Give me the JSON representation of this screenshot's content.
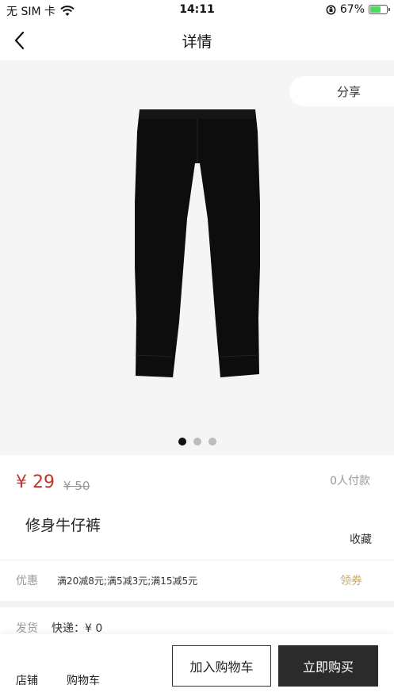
{
  "status_bar": {
    "carrier": "无 SIM 卡",
    "time": "14:11",
    "battery": "67%",
    "battery_level": 0.67
  },
  "nav": {
    "title": "详情",
    "back_icon": "chevron-left-icon"
  },
  "gallery": {
    "share_label": "分享",
    "image_subject": "black-pants",
    "dot_count": 3,
    "active_dot": 0
  },
  "price": {
    "current": "¥ 29",
    "original": "¥ 50",
    "paid_count": "0人付款"
  },
  "product": {
    "name": "修身牛仔裤",
    "favorite_label": "收藏"
  },
  "promo": {
    "label": "优惠",
    "text": "满20减8元;满5减3元;满15减5元",
    "coupon_label": "领券"
  },
  "shipping": {
    "label": "发货",
    "text": "快递：¥ 0"
  },
  "bottom_bar": {
    "store_label": "店铺",
    "cart_label": "购物车",
    "add_cart_label": "加入购物车",
    "buy_now_label": "立即购买"
  },
  "colors": {
    "price_red": "#c0392b",
    "coupon_gold": "#c8a96b",
    "buy_button": "#2b2b2b"
  }
}
